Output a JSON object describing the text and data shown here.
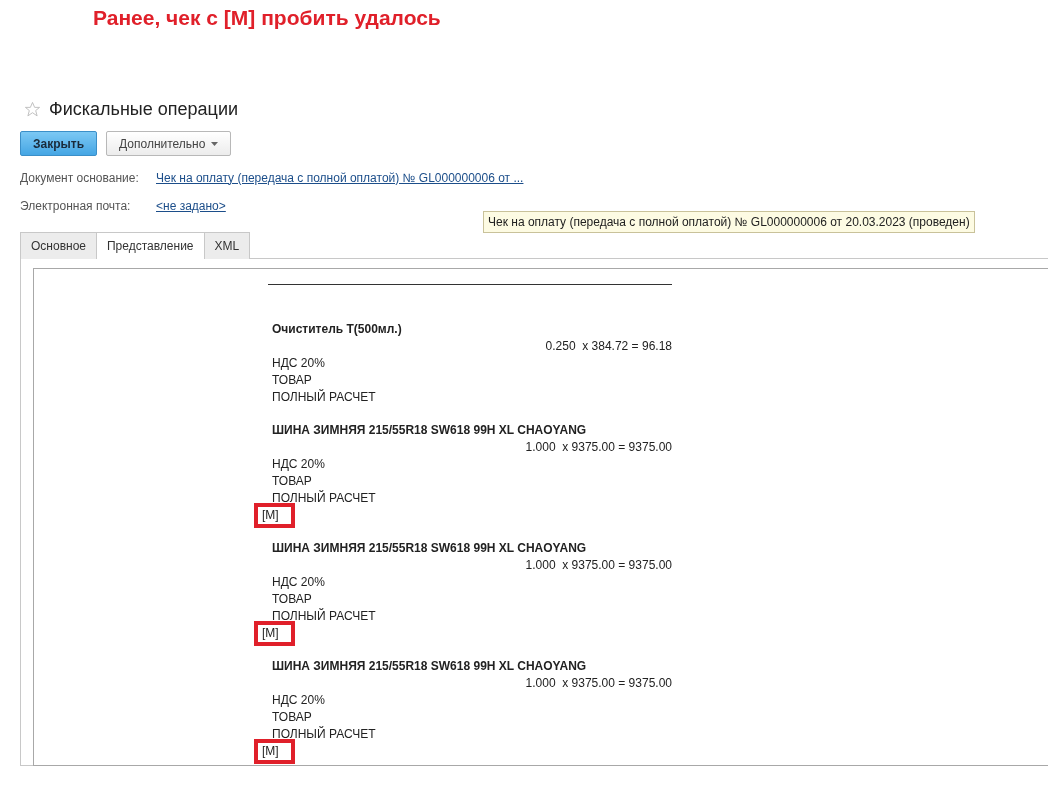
{
  "annotation_title": "Ранее, чек с [M] пробить удалось",
  "window": {
    "title": "Фискальные операции",
    "favorite": false
  },
  "buttons": [
    {
      "label": "Закрыть",
      "kind": "primary"
    },
    {
      "label": "Дополнительно",
      "kind": "dropdown"
    }
  ],
  "fields": [
    {
      "label": "Документ основание:",
      "value": "Чек на оплату (передача с полной оплатой) № GL000000006 от ..."
    },
    {
      "label": "Электронная почта:",
      "value": "<не задано>"
    }
  ],
  "tooltip": "Чек на оплату (передача с полной оплатой) № GL000000006 от 20.03.2023 (проведен)",
  "tabs": [
    {
      "label": "Основное",
      "selected": false
    },
    {
      "label": "Представление",
      "selected": true
    },
    {
      "label": "XML",
      "selected": false
    }
  ],
  "receipt": {
    "items": [
      {
        "name": "Очиститель Т(500мл.)",
        "calc": "0.250  x 384.72 = 96.18",
        "lines": [
          "НДС 20%",
          "ТОВАР",
          "ПОЛНЫЙ РАСЧЕТ"
        ]
      },
      {
        "name": "ШИНА ЗИМНЯЯ 215/55R18 SW618 99H XL CHAOYANG",
        "calc": "1.000  x 9375.00 = 9375.00",
        "lines": [
          "НДС 20%",
          "ТОВАР",
          "ПОЛНЫЙ РАСЧЕТ"
        ],
        "mark": "[M]",
        "highlighted": true
      },
      {
        "name": "ШИНА ЗИМНЯЯ 215/55R18 SW618 99H XL CHAOYANG",
        "calc": "1.000  x 9375.00 = 9375.00",
        "lines": [
          "НДС 20%",
          "ТОВАР",
          "ПОЛНЫЙ РАСЧЕТ"
        ],
        "mark": "[M]",
        "highlighted": true
      },
      {
        "name": "ШИНА ЗИМНЯЯ 215/55R18 SW618 99H XL CHAOYANG",
        "calc": "1.000  x 9375.00 = 9375.00",
        "lines": [
          "НДС 20%",
          "ТОВАР",
          "ПОЛНЫЙ РАСЧЕТ"
        ],
        "mark": "[M]",
        "highlighted": true
      }
    ]
  }
}
